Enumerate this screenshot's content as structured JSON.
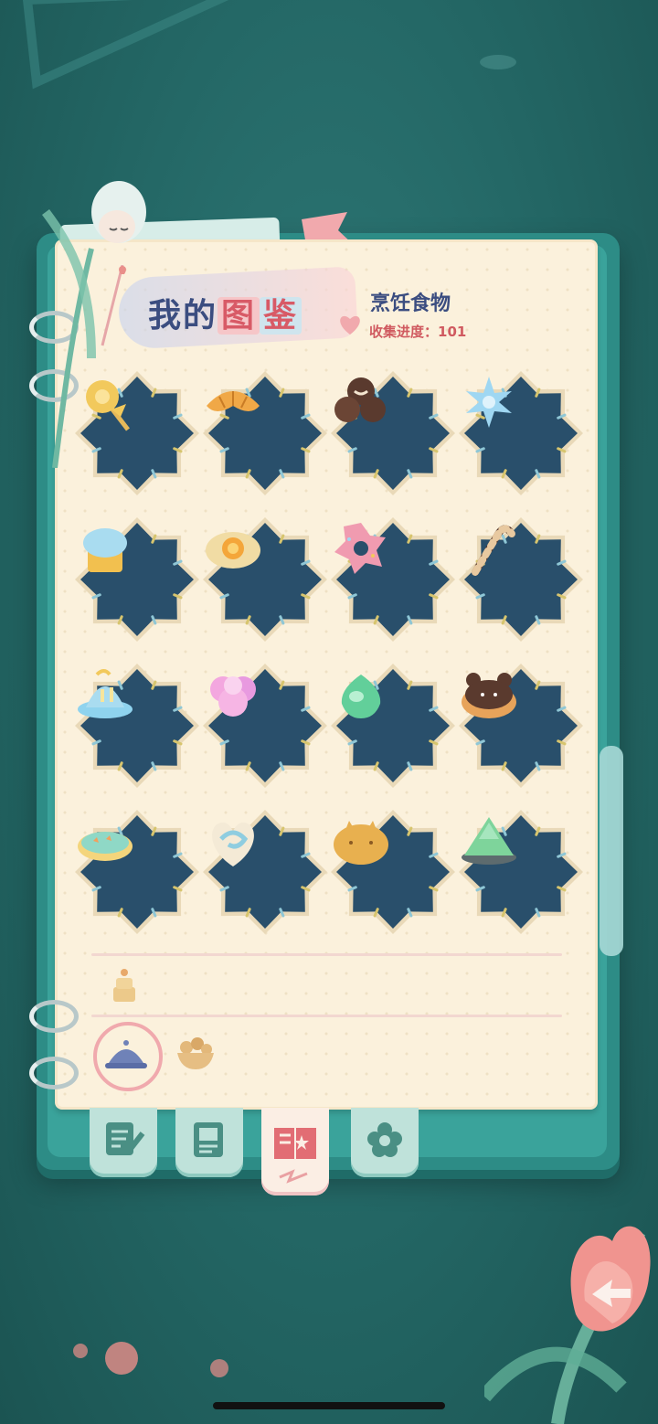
{
  "header": {
    "title_part1": "我的",
    "title_highlight1": "图",
    "title_highlight2": "鉴",
    "category": "烹饪食物",
    "progress_label": "收集进度：",
    "progress_value": "101"
  },
  "colors": {
    "badge_fill": "#294f6b",
    "badge_outer": "#e9d9b8",
    "accent_pink": "#d85a66",
    "title_blue": "#3b4d80",
    "tab_active": "#fbeee4",
    "tab_inactive": "#bfe2da"
  },
  "items": [
    {
      "name": "lollipop-icon"
    },
    {
      "name": "croissant-icon"
    },
    {
      "name": "chocolate-cookies-icon"
    },
    {
      "name": "snowflake-candy-icon"
    },
    {
      "name": "muffin-icon"
    },
    {
      "name": "egg-tart-icon"
    },
    {
      "name": "donut-icon"
    },
    {
      "name": "candy-cane-icon"
    },
    {
      "name": "blue-cake-icon"
    },
    {
      "name": "cotton-candy-icon"
    },
    {
      "name": "green-mochi-icon"
    },
    {
      "name": "bear-donut-icon"
    },
    {
      "name": "star-cookie-icon"
    },
    {
      "name": "heart-swirl-bread-icon"
    },
    {
      "name": "cat-bun-icon"
    },
    {
      "name": "mountain-jelly-icon"
    }
  ],
  "bottom_tabs": [
    {
      "name": "tab-notes",
      "icon": "note-pencil-icon"
    },
    {
      "name": "tab-album",
      "icon": "photo-book-icon"
    },
    {
      "name": "tab-encyclopedia",
      "icon": "book-star-icon"
    },
    {
      "name": "tab-flower",
      "icon": "flower-icon"
    }
  ]
}
